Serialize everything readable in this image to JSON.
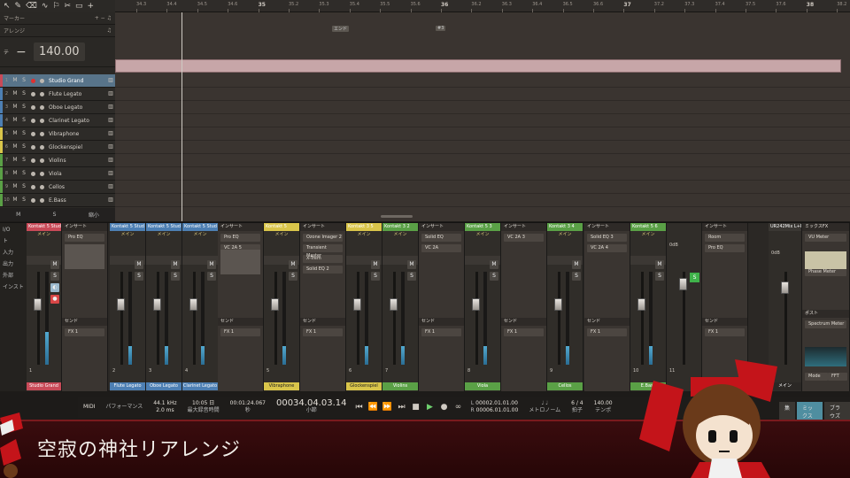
{
  "ruler": {
    "ticks": [
      {
        "label": "34.3",
        "major": false
      },
      {
        "label": "34.4",
        "major": false
      },
      {
        "label": "34.5",
        "major": false
      },
      {
        "label": "34.6",
        "major": false
      },
      {
        "label": "35",
        "major": true
      },
      {
        "label": "35.2",
        "major": false
      },
      {
        "label": "35.3",
        "major": false
      },
      {
        "label": "35.4",
        "major": false
      },
      {
        "label": "35.5",
        "major": false
      },
      {
        "label": "35.6",
        "major": false
      },
      {
        "label": "36",
        "major": true
      },
      {
        "label": "36.2",
        "major": false
      },
      {
        "label": "36.3",
        "major": false
      },
      {
        "label": "36.4",
        "major": false
      },
      {
        "label": "36.5",
        "major": false
      },
      {
        "label": "36.6",
        "major": false
      },
      {
        "label": "37",
        "major": true
      },
      {
        "label": "37.2",
        "major": false
      },
      {
        "label": "37.3",
        "major": false
      },
      {
        "label": "37.4",
        "major": false
      },
      {
        "label": "37.5",
        "major": false
      },
      {
        "label": "37.6",
        "major": false
      },
      {
        "label": "38",
        "major": true
      },
      {
        "label": "38.2",
        "major": false
      }
    ],
    "marker_end": "エンド",
    "marker_3": "#3"
  },
  "leftpanel": {
    "marker_label": "マーカー",
    "arrange_label": "アレンジ",
    "tempo_label": "テ",
    "tempo_value": "140.00"
  },
  "tracks": [
    {
      "num": "1",
      "name": "Studio Grand",
      "color": "#c94a58",
      "selected": true
    },
    {
      "num": "2",
      "name": "Flute Legato",
      "color": "#4d7fb3",
      "selected": false
    },
    {
      "num": "3",
      "name": "Oboe Legato",
      "color": "#4d7fb3",
      "selected": false
    },
    {
      "num": "4",
      "name": "Clarinet Legato",
      "color": "#4d7fb3",
      "selected": false
    },
    {
      "num": "5",
      "name": "Vibraphone",
      "color": "#d9c54a",
      "selected": false
    },
    {
      "num": "6",
      "name": "Glockenspiel",
      "color": "#d9c54a",
      "selected": false
    },
    {
      "num": "7",
      "name": "Violins",
      "color": "#5aa046",
      "selected": false
    },
    {
      "num": "8",
      "name": "Viola",
      "color": "#5aa046",
      "selected": false
    },
    {
      "num": "9",
      "name": "Cellos",
      "color": "#5aa046",
      "selected": false
    },
    {
      "num": "10",
      "name": "E.Bass",
      "color": "#5aa046",
      "selected": false
    }
  ],
  "track_buttons": {
    "mute": "M",
    "solo": "S"
  },
  "leftpanel_footer": {
    "m": "M",
    "s": "S",
    "shrink": "縮小"
  },
  "mixer_side": [
    "I/O",
    "ト",
    "入力",
    "出力",
    "外部",
    "インスト"
  ],
  "channels": [
    {
      "header": "Kontakt 5 Stud",
      "sub": "メイン",
      "vol": "+4.4",
      "pan": "<C>",
      "num": "1",
      "name": "Studio Grand",
      "color": "#c94a58",
      "meter": 0.35
    },
    {
      "header": "Kontakt 5 Stud",
      "sub": "メイン",
      "vol": "+2.4",
      "pan": "L29",
      "num": "2",
      "name": "Flute Legato",
      "color": "#4d7fb3",
      "meter": 0.2
    },
    {
      "header": "Kontakt 5 Stud",
      "sub": "メイン",
      "vol": "+3.4",
      "pan": "R18",
      "num": "3",
      "name": "Oboe Legato",
      "color": "#4d7fb3",
      "meter": 0.2
    },
    {
      "header": "Kontakt 5 Stud",
      "sub": "メイン",
      "vol": "+2.8",
      "pan": "<C>",
      "num": "4",
      "name": "Clarinet Legato",
      "color": "#4d7fb3",
      "meter": 0.2
    },
    {
      "header": "Kontakt 5",
      "sub": "メイン",
      "vol": "-2.6",
      "pan": "R90",
      "num": "5",
      "name": "Vibraphone",
      "color": "#d9c54a",
      "meter": 0.2
    },
    {
      "header": "Kontakt 3 5",
      "sub": "メイン",
      "vol": "-7.1",
      "pan": "L92",
      "num": "6",
      "name": "Glockenspiel",
      "color": "#d9c54a",
      "meter": 0.2
    },
    {
      "header": "Kontakt 3 2",
      "sub": "メイン",
      "vol": "-1.9",
      "pan": "L50",
      "num": "7",
      "name": "Violins",
      "color": "#5aa046",
      "meter": 0.2
    },
    {
      "header": "Kontakt 5 3",
      "sub": "メイン",
      "vol": "-3.7",
      "pan": "R20",
      "num": "8",
      "name": "Viola",
      "color": "#5aa046",
      "meter": 0.2
    },
    {
      "header": "Kontakt 3 4",
      "sub": "メイン",
      "vol": "-3.1",
      "pan": "R40",
      "num": "9",
      "name": "Cellos",
      "color": "#5aa046",
      "meter": 0.2
    },
    {
      "header": "Kontakt 5 6",
      "sub": "メイン",
      "vol": "-22.7",
      "pan": "<C>",
      "num": "10",
      "name": "E.Bass",
      "color": "#5aa046",
      "meter": 0.2
    }
  ],
  "inserts": [
    {
      "header": "インサート",
      "slots": [
        "Pro EQ"
      ],
      "send_label": "センド",
      "send": "FX 1"
    },
    {
      "header": "インサート",
      "slots": [
        "Pro EQ",
        "VC 2A 5"
      ],
      "send_label": "センド",
      "send": "FX 1"
    },
    {
      "header": "インサート",
      "slots": [
        "Ozone Imager 2",
        "Transient Master",
        "X-Trem",
        "Solid EQ 2"
      ],
      "send_label": "センド",
      "send": "FX 1"
    },
    {
      "header": "インサート",
      "slots": [
        "Solid EQ",
        "VC 2A"
      ],
      "send_label": "センド",
      "send": "FX 1"
    },
    {
      "header": "インサート",
      "slots": [
        "VC 2A 3"
      ],
      "send_label": "センド",
      "send": "FX 1"
    },
    {
      "header": "インサート",
      "slots": [
        "Solid EQ 3",
        "VC 2A 4"
      ],
      "send_label": "センド",
      "send": "FX 1"
    },
    {
      "header": "インサート",
      "slots": [
        "Room",
        "Pro EQ"
      ],
      "send_label": "センド",
      "send": "FX 1"
    }
  ],
  "fx_channel": {
    "vol": "0dB",
    "num": "11",
    "solo": "S"
  },
  "master": {
    "header": "UR242Mix L+R",
    "vol": "0dB",
    "sub": "メイン"
  },
  "master_inserts": {
    "header": "ミックスFX",
    "slots": [
      "VU Meter",
      "Phase Meter",
      "Spectrum Meter"
    ],
    "post": "ポスト",
    "mode": "Mode",
    "fft": "FFT"
  },
  "transport": {
    "midi": "MIDI",
    "perf": "パフォーマンス",
    "rate": "44.1 kHz",
    "latency": "2.0 ms",
    "rec_time": "10:05 日",
    "rec_label": "最大録音時間",
    "time": "00:01:24.067",
    "time_label": "秒",
    "bars": "00034.04.03.14",
    "bars_label": "小節",
    "loop_l": "00002.01.01.00",
    "loop_r": "00006.01.01.00",
    "loop_l_label": "L",
    "loop_r_label": "R",
    "metronome": "メトロノーム",
    "signature": "6 / 4",
    "signature_label": "拍子",
    "tempo": "140.00",
    "tempo_label": "テンポ"
  },
  "mix_tabs": [
    "集",
    "ミックス",
    "ブラウズ"
  ],
  "caption": "空寂の神社リアレンジ"
}
